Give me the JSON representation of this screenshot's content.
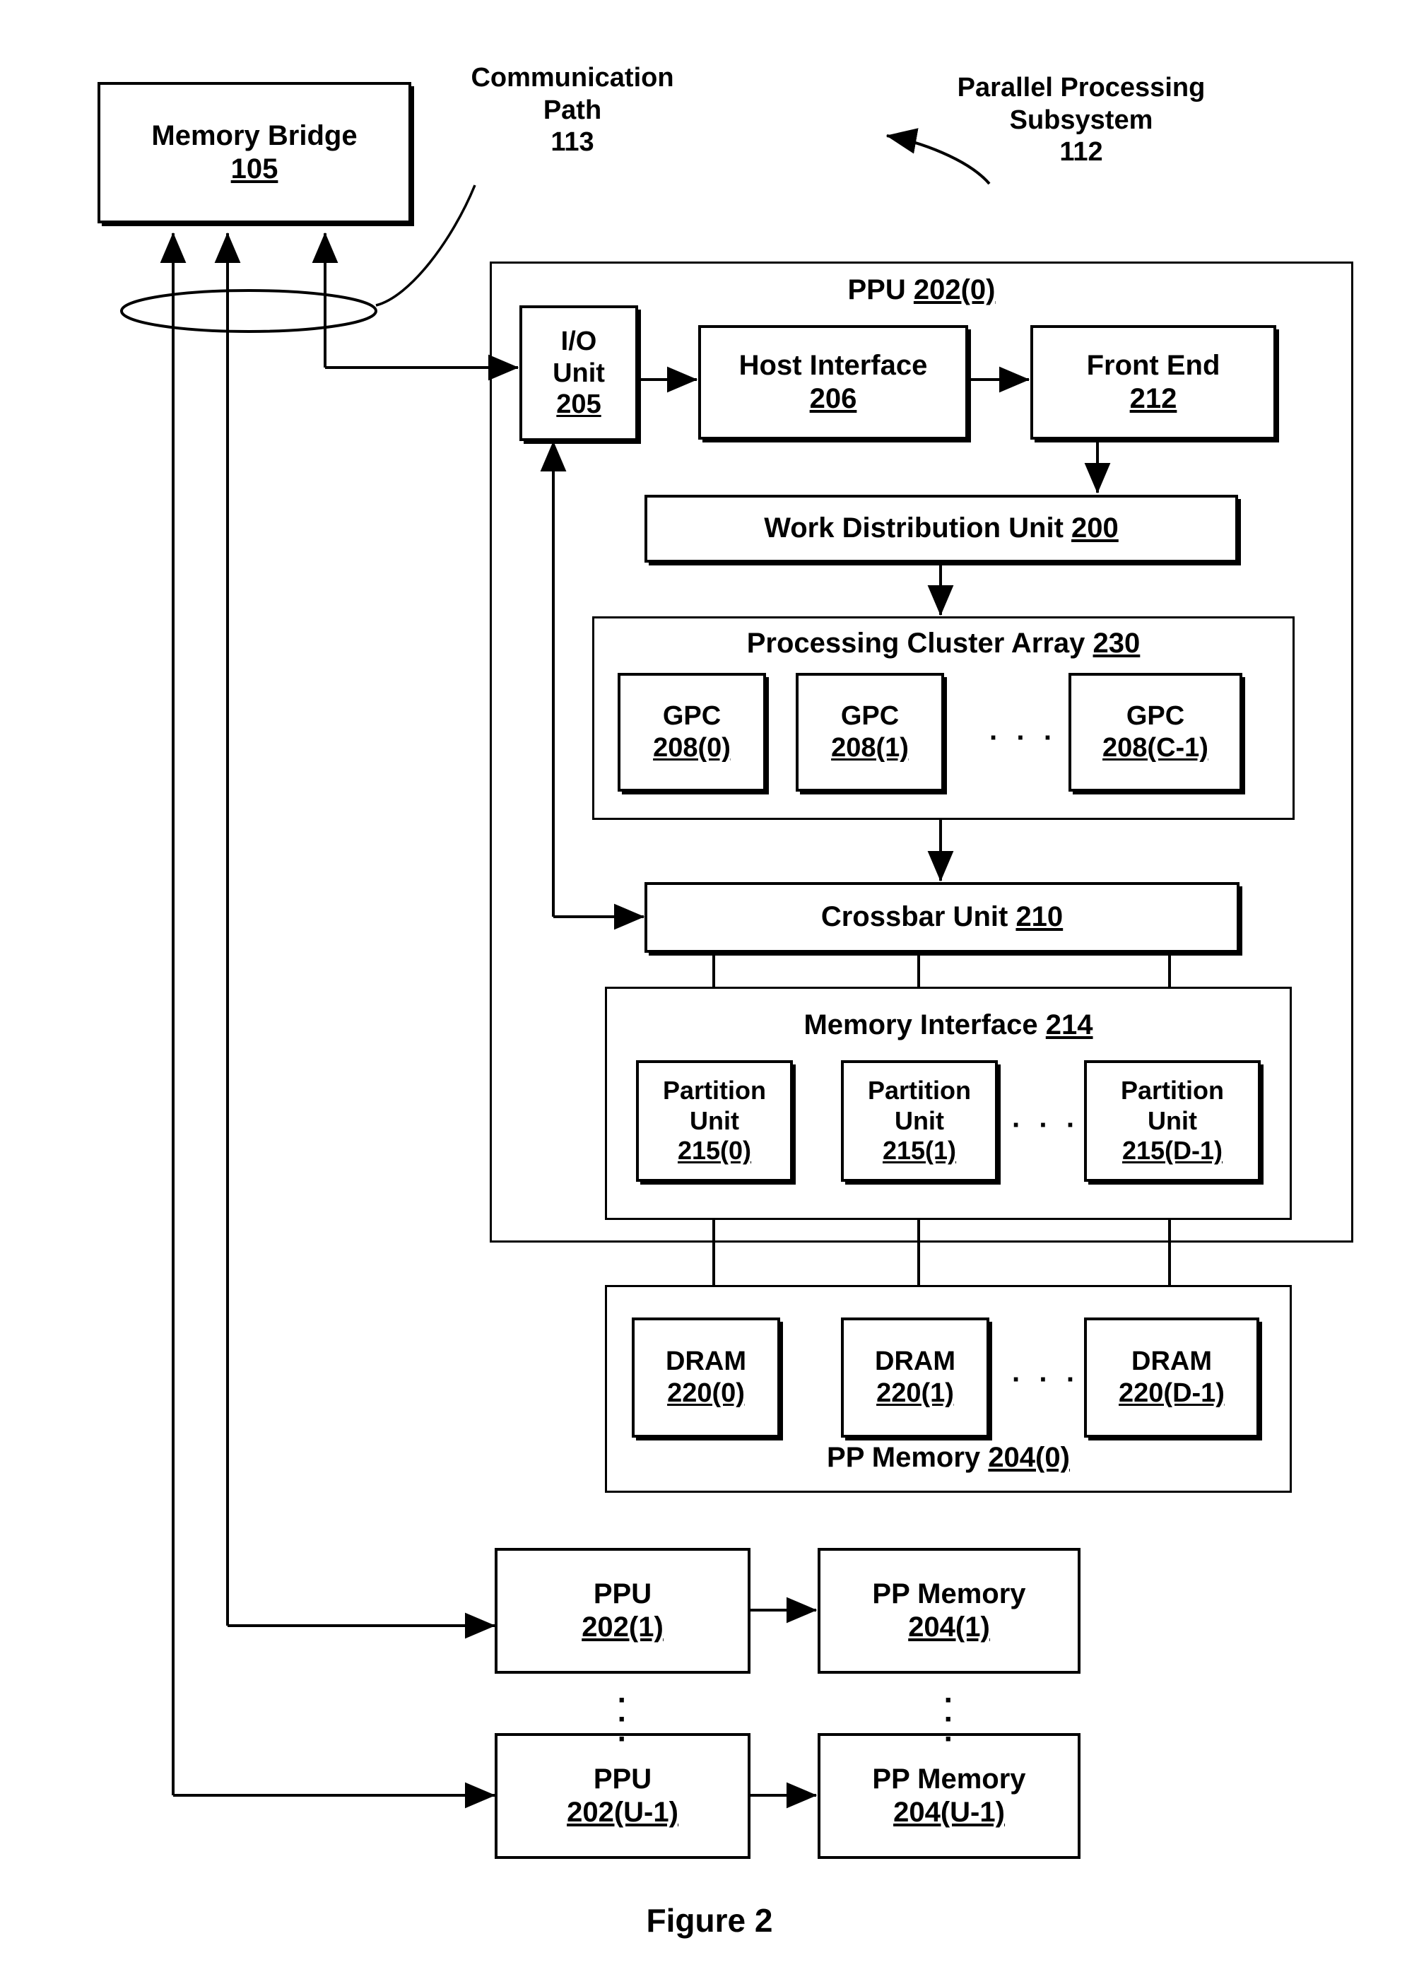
{
  "figure": {
    "caption": "Figure 2"
  },
  "labels": {
    "communication_path": {
      "line1": "Communication",
      "line2": "Path",
      "number": "113"
    },
    "parallel_processing_subsystem": {
      "line1": "Parallel Processing",
      "line2": "Subsystem",
      "number": "112"
    }
  },
  "memory_bridge": {
    "label": "Memory Bridge",
    "number": "105"
  },
  "ppu0": {
    "title_label": "PPU",
    "title_number": "202(0)",
    "io_unit": {
      "line1": "I/O",
      "line2": "Unit",
      "number": "205"
    },
    "host_interface": {
      "label": "Host Interface",
      "number": "206"
    },
    "front_end": {
      "label": "Front End",
      "number": "212"
    },
    "work_distribution_unit": {
      "label": "Work Distribution Unit",
      "number": "200"
    },
    "processing_cluster_array": {
      "label": "Processing Cluster Array",
      "number": "230",
      "ellipsis": "· · ·",
      "gpcs": [
        {
          "label": "GPC",
          "number": "208(0)"
        },
        {
          "label": "GPC",
          "number": "208(1)"
        },
        {
          "label": "GPC",
          "number": "208(C-1)"
        }
      ]
    },
    "crossbar_unit": {
      "label": "Crossbar Unit",
      "number": "210"
    },
    "memory_interface": {
      "label": "Memory Interface",
      "number": "214",
      "ellipsis": "· · ·",
      "partition_units": [
        {
          "line1": "Partition",
          "line2": "Unit",
          "number": "215(0)"
        },
        {
          "line1": "Partition",
          "line2": "Unit",
          "number": "215(1)"
        },
        {
          "line1": "Partition",
          "line2": "Unit",
          "number": "215(D-1)"
        }
      ]
    }
  },
  "pp_memory0": {
    "label": "PP Memory",
    "number": "204(0)",
    "ellipsis": "· · ·",
    "drams": [
      {
        "label": "DRAM",
        "number": "220(0)"
      },
      {
        "label": "DRAM",
        "number": "220(1)"
      },
      {
        "label": "DRAM",
        "number": "220(D-1)"
      }
    ]
  },
  "additional_units": [
    {
      "ppu": {
        "label": "PPU",
        "number": "202(1)"
      },
      "memory": {
        "label": "PP Memory",
        "number": "204(1)"
      }
    },
    {
      "ppu": {
        "label": "PPU",
        "number": "202(U-1)"
      },
      "memory": {
        "label": "PP Memory",
        "number": "204(U-1)"
      }
    }
  ],
  "vertical_ellipsis": "·\n·\n·",
  "colors": {
    "stroke": "#000000",
    "background": "#ffffff"
  }
}
